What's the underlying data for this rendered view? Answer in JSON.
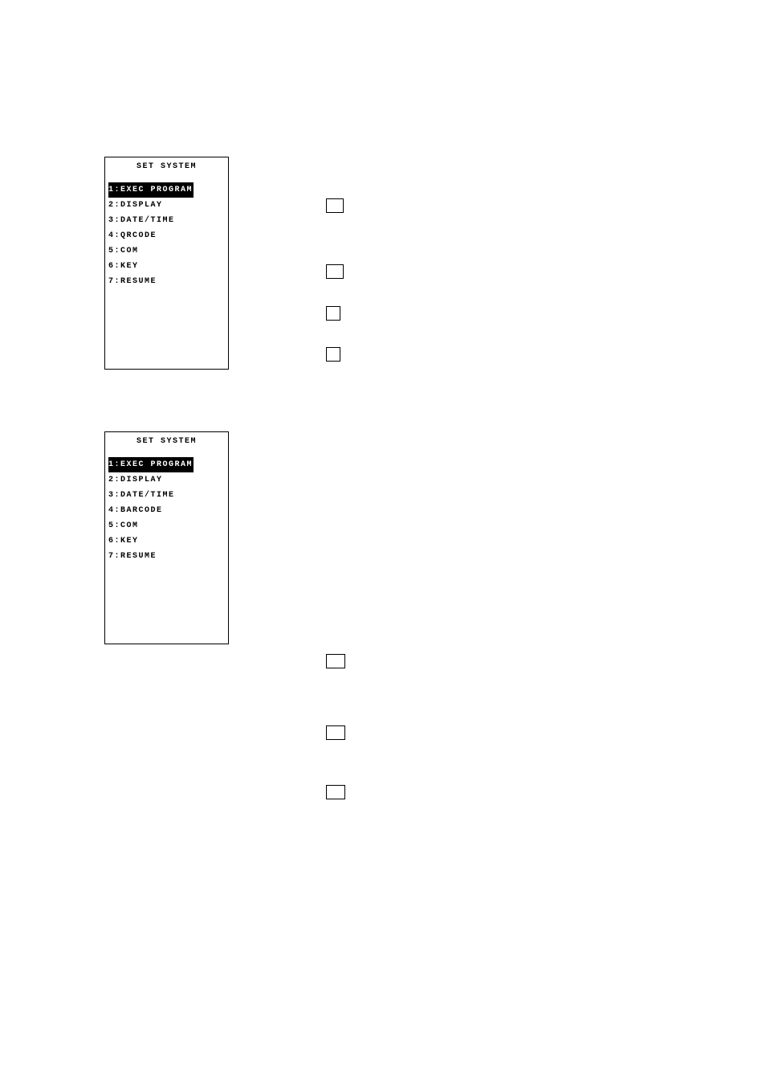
{
  "screens": {
    "top": {
      "title": "SET SYSTEM",
      "items": [
        {
          "label": "1:EXEC PROGRAM",
          "highlighted": true
        },
        {
          "label": "2:DISPLAY",
          "highlighted": false
        },
        {
          "label": "3:DATE/TIME",
          "highlighted": false
        },
        {
          "label": "4:QRCODE",
          "highlighted": false
        },
        {
          "label": "5:COM",
          "highlighted": false
        },
        {
          "label": "6:KEY",
          "highlighted": false
        },
        {
          "label": "7:RESUME",
          "highlighted": false
        }
      ]
    },
    "bottom": {
      "title": "SET SYSTEM",
      "items": [
        {
          "label": "1:EXEC PROGRAM",
          "highlighted": true
        },
        {
          "label": "2:DISPLAY",
          "highlighted": false
        },
        {
          "label": "3:DATE/TIME",
          "highlighted": false
        },
        {
          "label": "4:BARCODE",
          "highlighted": false
        },
        {
          "label": "5:COM",
          "highlighted": false
        },
        {
          "label": "6:KEY",
          "highlighted": false
        },
        {
          "label": "7:RESUME",
          "highlighted": false
        }
      ]
    }
  }
}
